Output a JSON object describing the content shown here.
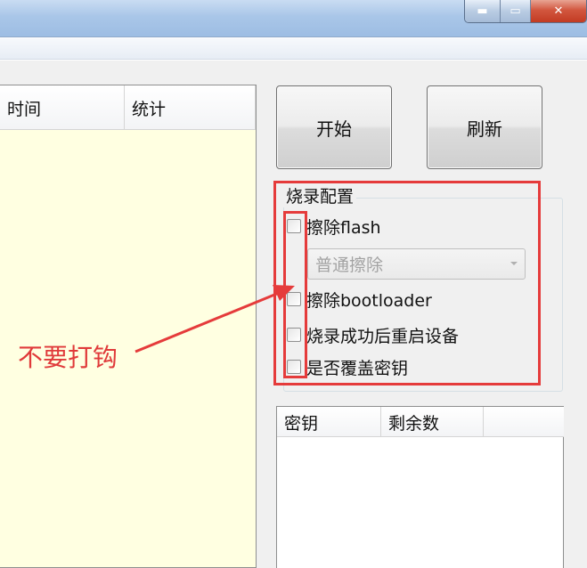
{
  "titlebar": {
    "minimize_glyph": "▬",
    "maximize_glyph": "▭",
    "close_glyph": "✕"
  },
  "log_list": {
    "columns": [
      "时间",
      "统计"
    ]
  },
  "buttons": {
    "start_label": "开始",
    "refresh_label": "刷新"
  },
  "burn_config": {
    "title": "烧录配置",
    "erase_flash_label": "擦除flash",
    "erase_mode": {
      "selected": "普通擦除"
    },
    "erase_bootloader_label": "擦除bootloader",
    "restart_after_success_label": "烧录成功后重启设备",
    "overwrite_key_label": "是否覆盖密钥"
  },
  "annotation": {
    "text": "不要打钩",
    "color": "#e03a3a"
  },
  "key_list": {
    "columns": [
      "密钥",
      "剩余数"
    ]
  },
  "colors": {
    "list_background": "#ffffe1",
    "highlight": "#e53b3b"
  }
}
